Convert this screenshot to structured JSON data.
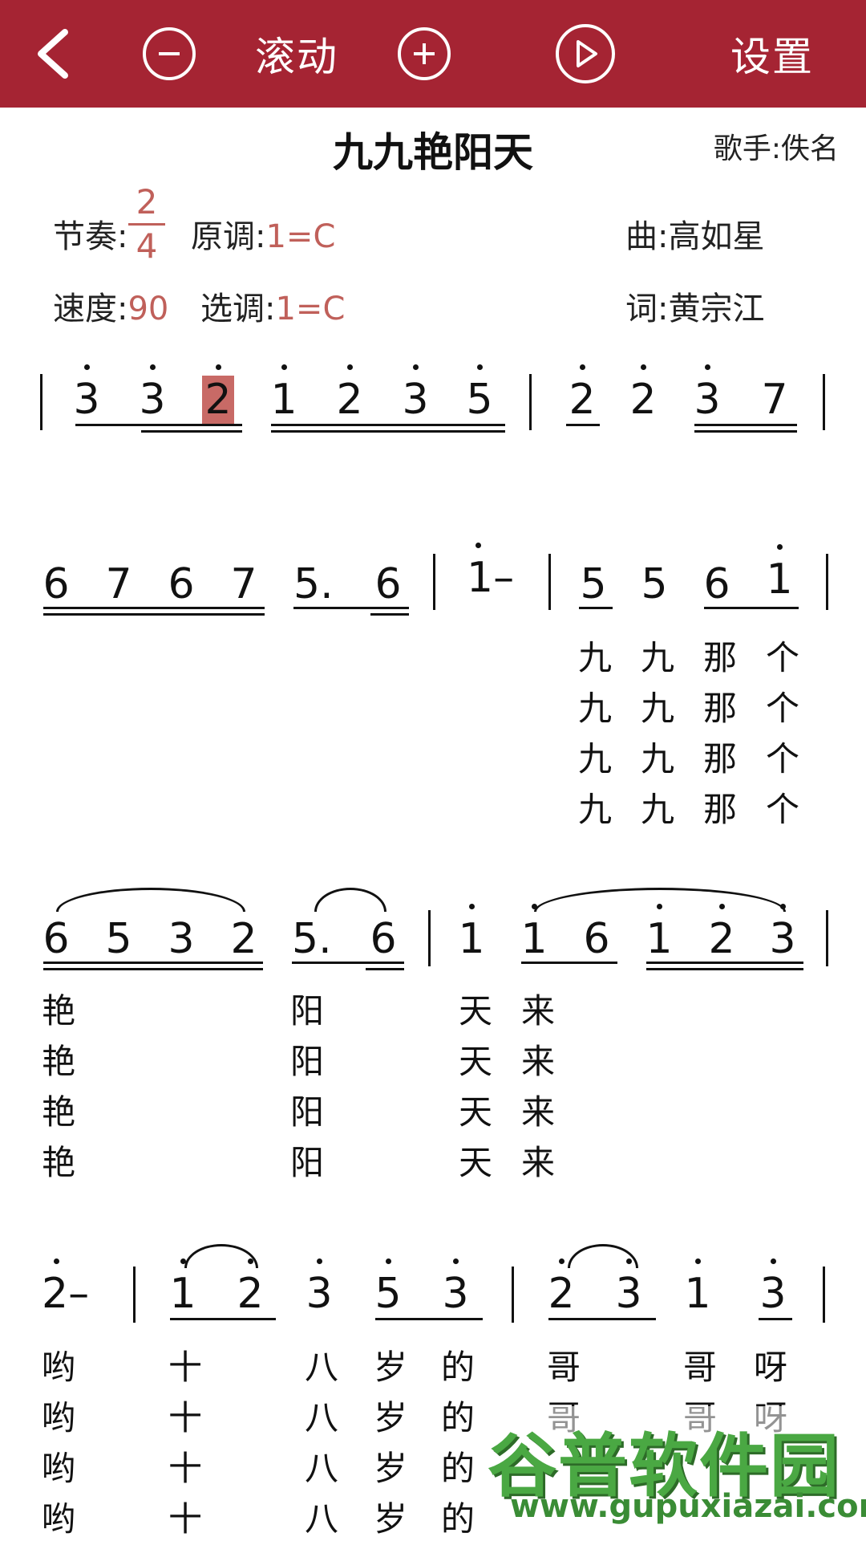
{
  "toolbar": {
    "back_label": "",
    "scroll_label": "滚动",
    "settings_label": "设置"
  },
  "header": {
    "title": "九九艳阳天",
    "singer": "歌手:佚名",
    "rhythm_label": "节奏:",
    "time_sig_top": "2",
    "time_sig_bottom": "4",
    "orig_key_label": "原调:",
    "orig_key_value": "1=C",
    "composer": "曲:高如星",
    "tempo_label": "速度:",
    "tempo_value": "90",
    "sel_key_label": "选调:",
    "sel_key_value": "1=C",
    "lyricist": "词:黄宗江"
  },
  "score": {
    "line1": [
      "3",
      "3",
      "2",
      "1",
      "2",
      "3",
      "5",
      "2",
      "2",
      "3",
      "7"
    ],
    "line2": [
      "6",
      "7",
      "6",
      "7",
      "5.",
      "6",
      "1–",
      "5",
      "5",
      "6",
      "1"
    ],
    "line2_lyrics": [
      "九",
      "九",
      "那",
      "个"
    ],
    "line3": [
      "6",
      "5",
      "3",
      "2",
      "5.",
      "6",
      "1",
      "1",
      "6",
      "1",
      "2",
      "3"
    ],
    "line3_lyrics": [
      "艳",
      "阳",
      "天",
      "来"
    ],
    "line4": [
      "2–",
      "1",
      "2",
      "3",
      "5",
      "3",
      "2",
      "3",
      "1",
      "3"
    ],
    "line4_lyrics": [
      "哟",
      "十",
      "八",
      "岁",
      "的",
      "哥",
      "哥",
      "呀"
    ]
  },
  "watermark": {
    "brand": "谷普软件园",
    "url": "www.gupuxiazai.com"
  },
  "colors": {
    "bar": "#a52433",
    "accent": "#c0605a",
    "highlight": "#c86a66"
  }
}
